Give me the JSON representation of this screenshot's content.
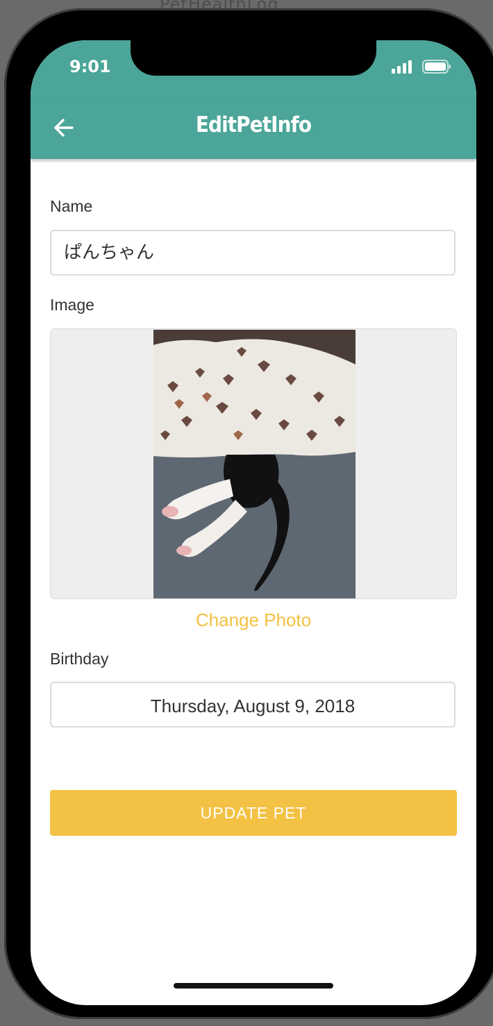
{
  "background_title": "PetHealthLog",
  "status_bar": {
    "time": "9:01",
    "signal_icon": "signal-bars-icon",
    "battery_icon": "battery-icon"
  },
  "app_bar": {
    "title": "EditPetInfo",
    "back_icon": "arrow-left-icon",
    "color": "#4ba598"
  },
  "form": {
    "name_label": "Name",
    "name_value": "ぱんちゃん",
    "image_label": "Image",
    "change_photo_label": "Change Photo",
    "birthday_label": "Birthday",
    "birthday_value": "Thursday, August 9, 2018"
  },
  "update_button": {
    "label": "UPDATE PET",
    "color": "#f3c143"
  },
  "accent_color": "#f4c040"
}
